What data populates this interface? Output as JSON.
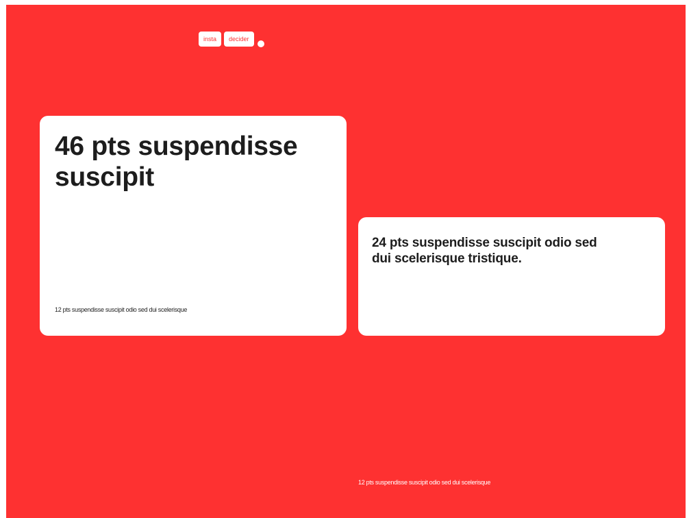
{
  "logo": {
    "word1": "insta",
    "word2": "decider"
  },
  "card_large": {
    "heading": "46 pts suspendisse suscipit",
    "caption": "12 pts suspendisse suscipit odio sed dui scelerisque"
  },
  "card_small": {
    "heading": "24 pts suspendisse suscipit odio sed dui scelerisque tristique."
  },
  "footer": {
    "caption": "12 pts suspendisse suscipit odio sed dui scelerisque"
  },
  "colors": {
    "background": "#fe3131",
    "card": "#ffffff",
    "text_dark": "#1d1d1d"
  }
}
